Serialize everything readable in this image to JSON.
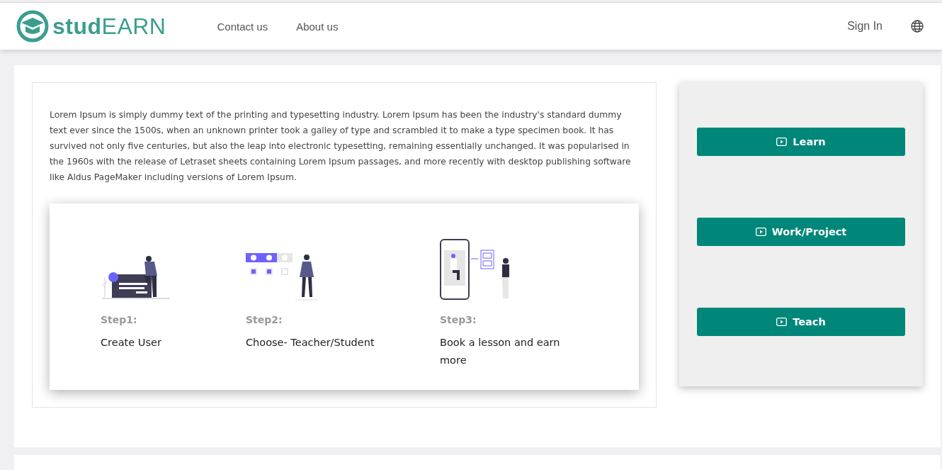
{
  "header": {
    "logo": "**stud**EARN",
    "nav": [
      "Contact us",
      "About us"
    ],
    "sign_in": "Sign In"
  },
  "intro": "Lorem Ipsum is simply dummy text of the printing and typesetting industry. Lorem Ipsum has been the industry's standard dummy text ever since the 1500s, when an unknown printer took a galley of type and scrambled it to make a type specimen book. It has survived not only five centuries, but also the leap into electronic typesetting, remaining essentially unchanged. It was popularised in the 1960s with the release of Letraset sheets containing Lorem Ipsum passages, and more recently with desktop publishing software like Aldus PageMaker including versions of Lorem Ipsum.",
  "steps": [
    {
      "kind": "user",
      "label": "Step1:",
      "title": "Create User"
    },
    {
      "kind": "choose",
      "label": "Step2:",
      "title": "Choose- Teacher/Student"
    },
    {
      "kind": "book",
      "label": "Step3:",
      "title": "Book a lesson and earn more"
    }
  ],
  "actions": [
    "Learn",
    "Work/Project",
    "Teach"
  ]
}
